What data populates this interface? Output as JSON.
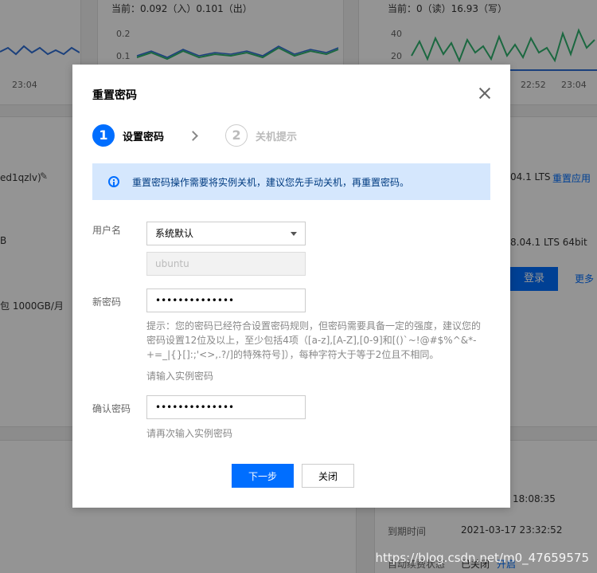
{
  "background": {
    "metric_center": "当前：0.092（入）0.101（出）",
    "metric_right": "当前：0（读）16.93（写）",
    "tick_left_x": "23:04",
    "tick_center_y1": "0.2",
    "tick_center_y2": "0.1",
    "tick_right_y1": "40",
    "tick_right_y2": "20",
    "tick_right_x1": "22:52",
    "tick_right_x2": "23:04",
    "instance_name_fragment": "ed1qzlv)",
    "left_b": "B",
    "bandwidth": "包 1000GB/月",
    "os_version": "04.1 LTS",
    "reinstall_link": "重置应用",
    "os_full": "8.04.1 LTS 64bit",
    "login_button": "登录",
    "more_link": "更多",
    "time_right": "18:08:35",
    "expire_label": "到期时间",
    "expire_value": "2021-03-17 23:32:52",
    "auto_renew_label": "自动续费状态",
    "auto_renew_value": "已关闭",
    "auto_renew_link": "开启"
  },
  "dialog": {
    "title": "重置密码",
    "steps": [
      {
        "num": "1",
        "label": "设置密码"
      },
      {
        "num": "2",
        "label": "关机提示"
      }
    ],
    "info": "重置密码操作需要将实例关机，建议您先手动关机，再重置密码。",
    "username_label": "用户名",
    "username_select": "系统默认",
    "username_value": "ubuntu",
    "new_password_label": "新密码",
    "new_password_value": "••••••••••••••",
    "password_hint": "提示：您的密码已经符合设置密码规则，但密码需要具备一定的强度，建议您的密码设置12位及以上，至少包括4项（[a-z],[A-Z],[0-9]和[()`~!@#$%^&*-+=_|{}[]:;'<>,.?/]的特殊符号]），每种字符大于等于2位且不相同。",
    "new_password_subhint": "请输入实例密码",
    "confirm_label": "确认密码",
    "confirm_value": "••••••••••••••",
    "confirm_subhint": "请再次输入实例密码",
    "next_button": "下一步",
    "close_button": "关闭"
  },
  "watermark": "https://blog.csdn.net/m0_47659575",
  "colors": {
    "primary": "#006eff",
    "info_bg": "#d5e7fd",
    "chart_blue": "#2f6fd6",
    "chart_green": "#2fb36e"
  }
}
